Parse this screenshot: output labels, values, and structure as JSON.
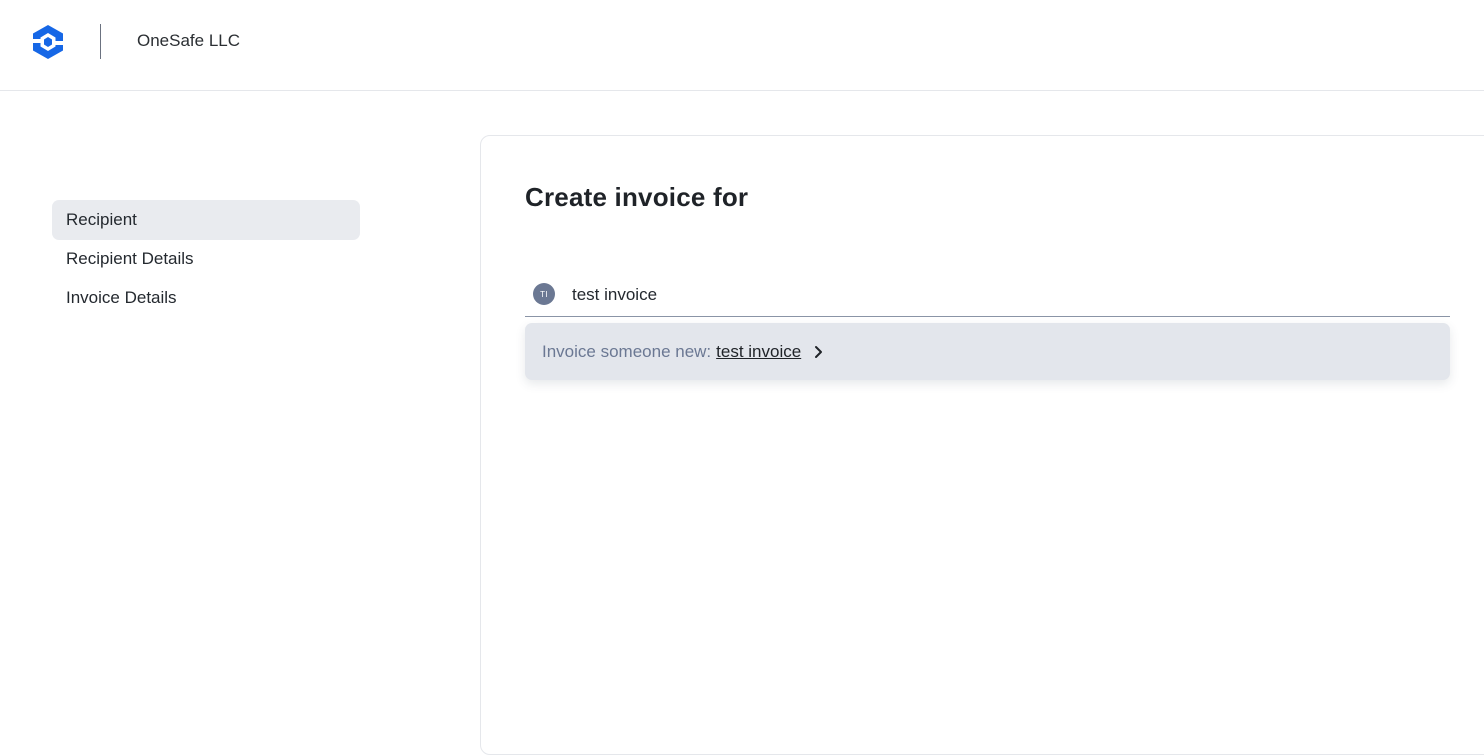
{
  "header": {
    "company_name": "OneSafe LLC",
    "logo_icon": "onesafe-hexagon-logo",
    "brand_color": "#1667e6"
  },
  "steps": [
    {
      "label": "Recipient",
      "active": true
    },
    {
      "label": "Recipient Details",
      "active": false
    },
    {
      "label": "Invoice Details",
      "active": false
    }
  ],
  "main": {
    "title": "Create invoice for",
    "search": {
      "avatar_initials": "TI",
      "value": "test invoice"
    },
    "suggestion": {
      "prefix": "Invoice someone new:",
      "name": "test invoice",
      "icon": "chevron-right-icon"
    }
  }
}
